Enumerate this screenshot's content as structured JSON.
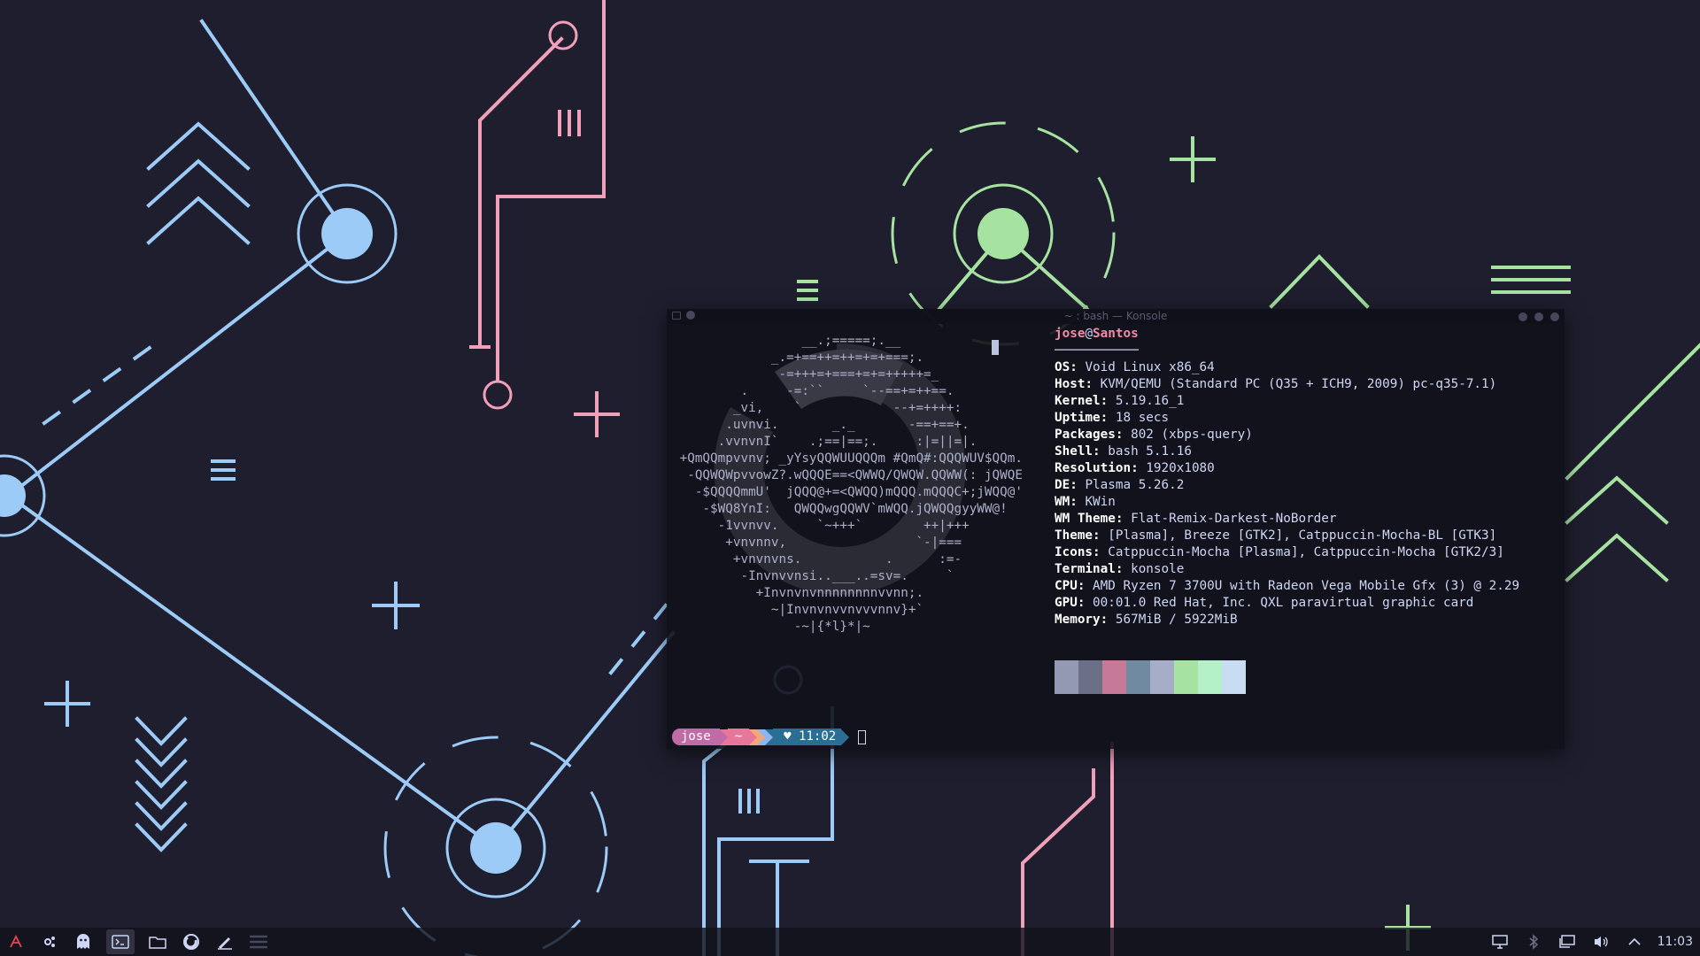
{
  "window": {
    "title": "~ : bash — Konsole"
  },
  "fetch": {
    "user": "jose",
    "at": "@",
    "host": "Santos",
    "underline": "───────────",
    "lines": [
      {
        "key": "OS",
        "value": "Void Linux x86_64"
      },
      {
        "key": "Host",
        "value": "KVM/QEMU (Standard PC (Q35 + ICH9, 2009) pc-q35-7.1)"
      },
      {
        "key": "Kernel",
        "value": "5.19.16_1"
      },
      {
        "key": "Uptime",
        "value": "18 secs"
      },
      {
        "key": "Packages",
        "value": "802 (xbps-query)"
      },
      {
        "key": "Shell",
        "value": "bash 5.1.16"
      },
      {
        "key": "Resolution",
        "value": "1920x1080"
      },
      {
        "key": "DE",
        "value": "Plasma 5.26.2"
      },
      {
        "key": "WM",
        "value": "KWin"
      },
      {
        "key": "WM Theme",
        "value": "Flat-Remix-Darkest-NoBorder"
      },
      {
        "key": "Theme",
        "value": "[Plasma], Breeze [GTK2], Catppuccin-Mocha-BL [GTK3]"
      },
      {
        "key": "Icons",
        "value": "Catppuccin-Mocha [Plasma], Catppuccin-Mocha [GTK2/3]"
      },
      {
        "key": "Terminal",
        "value": "konsole"
      },
      {
        "key": "CPU",
        "value": "AMD Ryzen 7 3700U with Radeon Vega Mobile Gfx (3) @ 2.29"
      },
      {
        "key": "GPU",
        "value": "00:01.0 Red Hat, Inc. QXL paravirtual graphic card"
      },
      {
        "key": "Memory",
        "value": "567MiB / 5922MiB"
      }
    ],
    "swatches": [
      "#9399b2",
      "#6c7086",
      "#c77a98",
      "#6f8aa1",
      "#a6adc8",
      "#a6e3a1",
      "#b4f0c8",
      "#c8dcf4"
    ]
  },
  "ascii_art": "                 __.;=====;.__\n             _.=+==++=++=+=+===;.\n              -=+++=+===+=+=+++++=_\n         .     -=:``     `--==+=++==.\n        _vi,    `            --+=++++:\n       .uvnvi.       _._       -==+==+.\n      .vvnvnI`    .;==|==;.     :|=||=|.\n +QmQQmpvvnv; _yYsyQQWUUQQQm #QmQ#:QQQWUV$QQm.\n  -QQWQWpvvowZ?.wQQQE==<QWWQ/QWQW.QQWW(: jQWQE\n   -$QQQQmmU'  jQQQ@+=<QWQQ)mQQQ.mQQQC+;jWQQ@'\n    -$WQ8YnI:   QWQQwgQQWV`mWQQ.jQWQQgyyWW@!\n      -1vvnvv.     `~+++`        ++|+++\n       +vnvnnv,                 `-|===\n        +vnvnvns.           .      :=-\n         -Invnvvnsi..___..=sv=.     `\n           +Invnvnvnnnnnnnnvvnn;.\n             ~|Invnvnvvnvvvnnv}+`\n                -~|{*l}*|~",
  "prompt": {
    "user": "jose",
    "dir": "~",
    "heart": "♥",
    "time": "11:02"
  },
  "taskbar": {
    "apps": [
      "app-launcher-icon",
      "settings-icon",
      "ghost-icon",
      "terminal-icon",
      "folder-icon",
      "firefox-icon",
      "text-editor-icon",
      "menu-icon"
    ],
    "tray": [
      "display-icon",
      "bluetooth-icon",
      "network-icon",
      "volume-icon",
      "chevron-up-icon"
    ],
    "clock": "11:03"
  },
  "colors": {
    "background": "#1e1e2e",
    "blue": "#89b4fa",
    "pink": "#f38ba8",
    "green": "#a6e3a1"
  }
}
